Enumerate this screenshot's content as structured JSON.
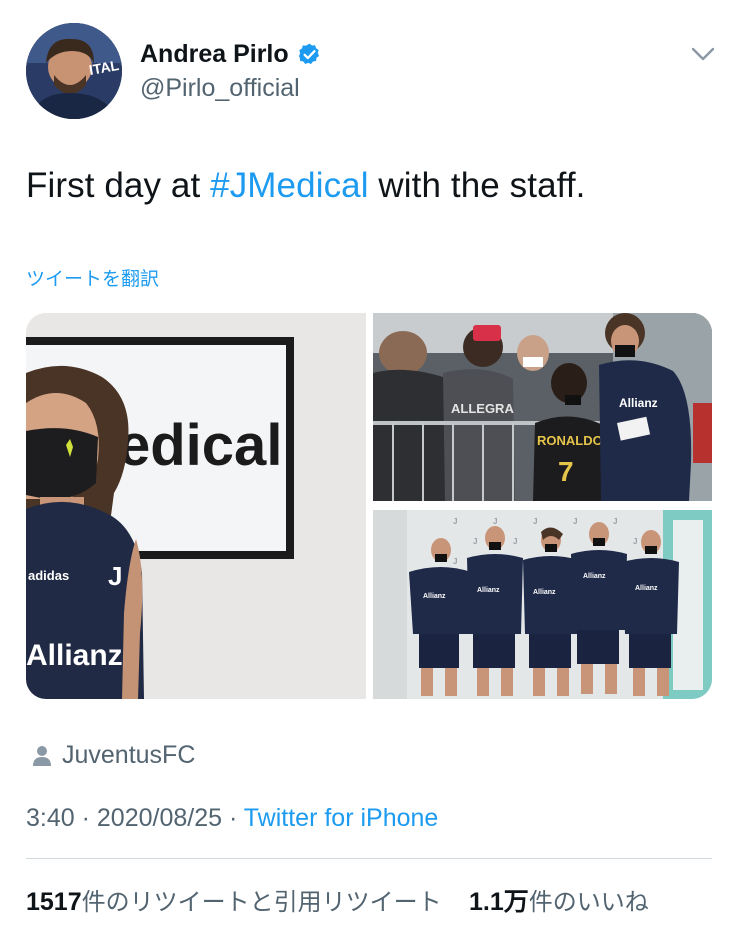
{
  "author": {
    "display_name": "Andrea Pirlo",
    "handle": "@Pirlo_official",
    "verified": true
  },
  "tweet": {
    "text_before": "First day at ",
    "hashtag": "#JMedical",
    "text_after": " with the staff.",
    "translate_label": "ツイートを翻訳"
  },
  "media": {
    "photo_1_sign_text": "edical",
    "photo_2_jersey_text": "RONALDO",
    "photo_2_jersey_number": "7"
  },
  "meta": {
    "source_label": "JuventusFC",
    "time": "3:40",
    "separator": " · ",
    "date": "2020/08/25",
    "client": "Twitter for iPhone"
  },
  "stats": {
    "retweets_count": "1517",
    "retweets_label": "件のリツイートと引用リツイート",
    "likes_count": "1.1万",
    "likes_label": "件のいいね"
  },
  "colors": {
    "accent": "#1d9bf0",
    "secondary_text": "#536471",
    "primary_text": "#0f1419",
    "divider": "#cfd9de"
  },
  "icons": {
    "verified": "verified-badge-icon",
    "menu": "chevron-down-icon",
    "source": "person-icon"
  }
}
